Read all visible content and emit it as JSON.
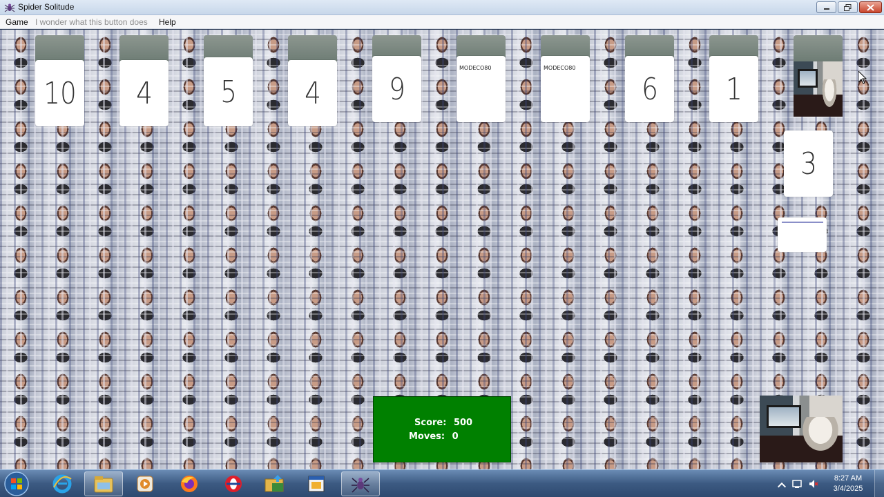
{
  "window": {
    "title": "Spider Solitude",
    "icon": "spider-icon"
  },
  "menu": {
    "items": [
      "Game",
      "I wonder what this button does",
      "Help"
    ]
  },
  "tableau": {
    "columns": [
      {
        "label": "10"
      },
      {
        "label": "4"
      },
      {
        "label": "5"
      },
      {
        "label": "4"
      },
      {
        "label": "9"
      },
      {
        "label": "MODECO80"
      },
      {
        "label": "MODECO80"
      },
      {
        "label": "6"
      },
      {
        "label": "1"
      },
      {
        "label": ""
      }
    ],
    "dragged_card": {
      "label": "3"
    }
  },
  "score": {
    "score_label": "Score:",
    "score_value": "500",
    "moves_label": "Moves:",
    "moves_value": "0"
  },
  "taskbar": {
    "apps": [
      "internet-explorer-icon",
      "file-explorer-icon",
      "media-player-icon",
      "firefox-icon",
      "opera-icon",
      "explorer-folder-icon",
      "program-window-icon",
      "spider-solitude-icon"
    ],
    "time": "8:27 AM",
    "date": "3/4/2025"
  },
  "colors": {
    "score_green": "#008000",
    "taskbar_blue": "#3c5a82"
  }
}
